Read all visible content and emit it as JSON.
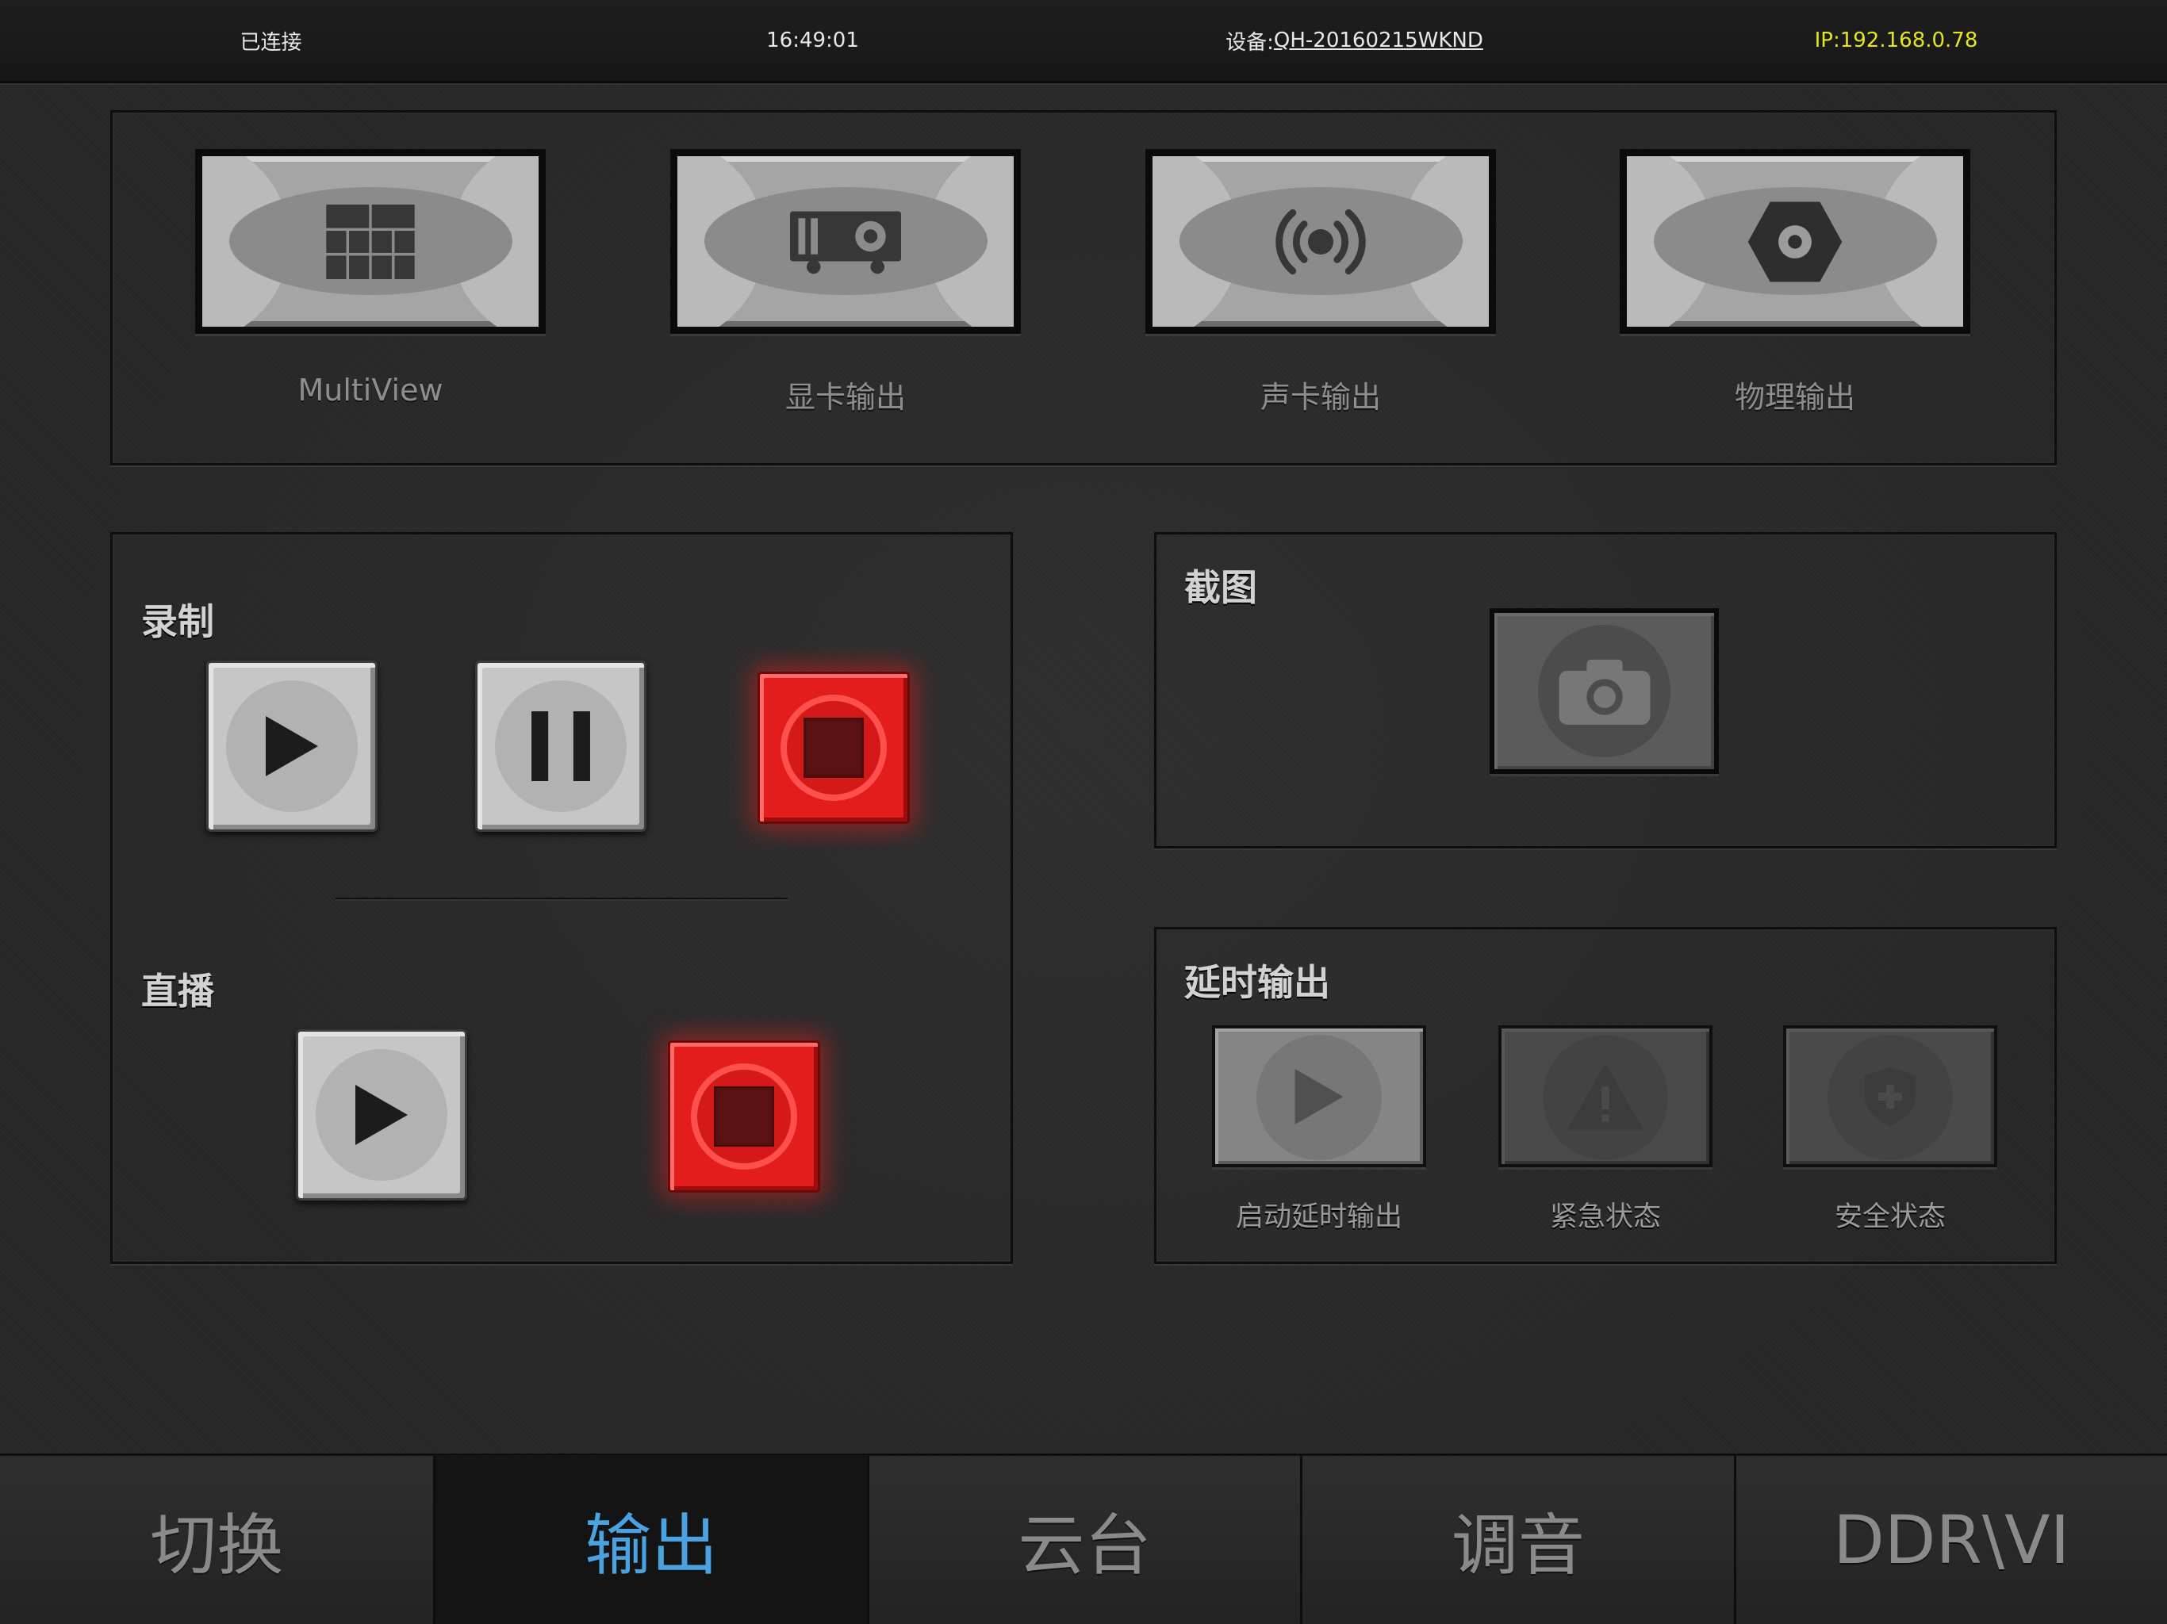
{
  "status_bar": {
    "connection": "已连接",
    "time": "16:49:01",
    "device_label": "设备:",
    "device_id": "QH-20160215WKND",
    "ip": "IP:192.168.0.78"
  },
  "output_buttons": [
    {
      "label": "MultiView",
      "icon": "multiview-grid-icon"
    },
    {
      "label": "显卡输出",
      "icon": "projector-icon"
    },
    {
      "label": "声卡输出",
      "icon": "broadcast-icon"
    },
    {
      "label": "物理输出",
      "icon": "hex-nut-icon"
    }
  ],
  "record": {
    "title": "录制",
    "controls": [
      {
        "icon": "play-icon",
        "lit": false
      },
      {
        "icon": "pause-icon",
        "lit": false
      },
      {
        "icon": "stop-icon",
        "lit": true
      }
    ]
  },
  "live": {
    "title": "直播",
    "controls": [
      {
        "icon": "play-icon",
        "lit": false
      },
      {
        "icon": "stop-icon",
        "lit": true
      }
    ]
  },
  "snapshot": {
    "title": "截图",
    "icon": "camera-icon"
  },
  "delay_output": {
    "title": "延时输出",
    "buttons": [
      {
        "label": "启动延时输出",
        "icon": "play-icon",
        "enabled": true
      },
      {
        "label": "紧急状态",
        "icon": "warning-icon",
        "enabled": false
      },
      {
        "label": "安全状态",
        "icon": "shield-icon",
        "enabled": false
      }
    ]
  },
  "tabs": [
    {
      "label": "切换",
      "active": false
    },
    {
      "label": "输出",
      "active": true
    },
    {
      "label": "云台",
      "active": false
    },
    {
      "label": "调音",
      "active": false
    },
    {
      "label": "DDR\\VI",
      "active": false
    }
  ],
  "colors": {
    "accent": "#4aa3e0",
    "ip_text": "#e6e41c",
    "stop_red": "#e31c1c"
  }
}
